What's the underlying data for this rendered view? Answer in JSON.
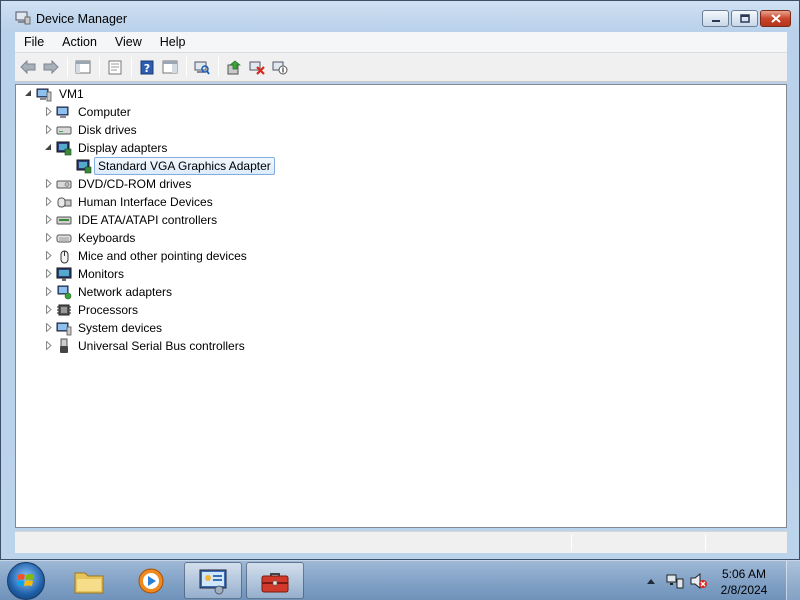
{
  "window": {
    "title": "Device Manager"
  },
  "menu": [
    "File",
    "Action",
    "View",
    "Help"
  ],
  "toolbar": {
    "buttons": [
      "back-icon",
      "forward-icon",
      "show-hide-console-tree-icon",
      "properties-icon",
      "help-icon",
      "show-action-pane-icon",
      "scan-hardware-icon",
      "update-driver-icon",
      "uninstall-icon",
      "disable-icon"
    ]
  },
  "tree": {
    "root": "VM1",
    "categories": [
      {
        "label": "Computer",
        "icon": "computer-icon",
        "expanded": false
      },
      {
        "label": "Disk drives",
        "icon": "disk-drive-icon",
        "expanded": false
      },
      {
        "label": "Display adapters",
        "icon": "display-adapter-icon",
        "expanded": true,
        "children": [
          "Standard VGA Graphics Adapter"
        ]
      },
      {
        "label": "DVD/CD-ROM drives",
        "icon": "dvd-drive-icon",
        "expanded": false
      },
      {
        "label": "Human Interface Devices",
        "icon": "hid-icon",
        "expanded": false
      },
      {
        "label": "IDE ATA/ATAPI controllers",
        "icon": "ide-controller-icon",
        "expanded": false
      },
      {
        "label": "Keyboards",
        "icon": "keyboard-icon",
        "expanded": false
      },
      {
        "label": "Mice and other pointing devices",
        "icon": "mouse-icon",
        "expanded": false
      },
      {
        "label": "Monitors",
        "icon": "monitor-icon",
        "expanded": false
      },
      {
        "label": "Network adapters",
        "icon": "network-adapter-icon",
        "expanded": false
      },
      {
        "label": "Processors",
        "icon": "processor-icon",
        "expanded": false
      },
      {
        "label": "System devices",
        "icon": "system-devices-icon",
        "expanded": false
      },
      {
        "label": "Universal Serial Bus controllers",
        "icon": "usb-icon",
        "expanded": false
      }
    ],
    "selected": "Standard VGA Graphics Adapter"
  },
  "taskbar": {
    "apps": [
      "explorer-folder-icon",
      "media-player-icon",
      "control-panel-icon",
      "toolbox-icon"
    ],
    "active_app": "toolbox-icon"
  },
  "clock": {
    "time": "5:06 AM",
    "date": "2/8/2024"
  },
  "colors": {
    "selection_border": "#84acdd",
    "selection_fill": "#dcebfc",
    "close_button": "#c9462c",
    "taskbar": "#86a5c8"
  }
}
